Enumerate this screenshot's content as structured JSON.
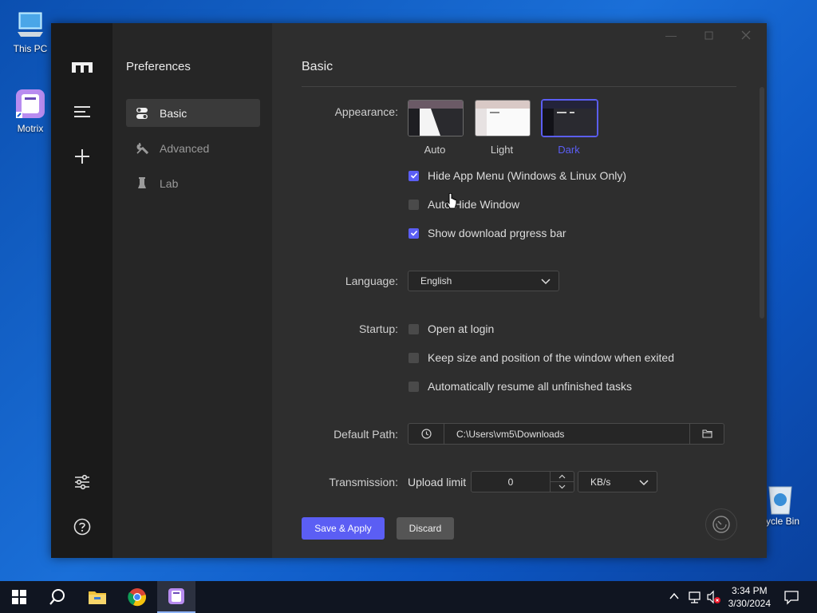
{
  "desktop": {
    "icons": [
      {
        "label": "This PC"
      },
      {
        "label": "Motrix"
      },
      {
        "label": "cycle Bin"
      }
    ]
  },
  "app": {
    "rail": {
      "icons": [
        "motrix-logo-icon",
        "menu-icon",
        "plus-icon",
        "settings-sliders-icon",
        "help-icon"
      ]
    },
    "subnav": {
      "title": "Preferences",
      "items": [
        {
          "label": "Basic",
          "icon": "toggle-icon",
          "active": true
        },
        {
          "label": "Advanced",
          "icon": "wrench-icon",
          "active": false
        },
        {
          "label": "Lab",
          "icon": "flask-icon",
          "active": false
        }
      ]
    },
    "main": {
      "title": "Basic",
      "appearance": {
        "label": "Appearance:",
        "options": [
          {
            "label": "Auto",
            "selected": false
          },
          {
            "label": "Light",
            "selected": false
          },
          {
            "label": "Dark",
            "selected": true
          }
        ],
        "checkboxes": [
          {
            "label": "Hide App Menu (Windows & Linux Only)",
            "checked": true
          },
          {
            "label": "Auto Hide Window",
            "checked": false
          },
          {
            "label": "Show download prgress bar",
            "checked": true
          }
        ]
      },
      "language": {
        "label": "Language:",
        "value": "English"
      },
      "startup": {
        "label": "Startup:",
        "checkboxes": [
          {
            "label": "Open at login",
            "checked": false
          },
          {
            "label": "Keep size and position of the window when exited",
            "checked": false
          },
          {
            "label": "Automatically resume all unfinished tasks",
            "checked": false
          }
        ]
      },
      "default_path": {
        "label": "Default Path:",
        "value": "C:\\Users\\vm5\\Downloads"
      },
      "transmission": {
        "label": "Transmission:",
        "upload_label": "Upload limit",
        "upload_value": "0",
        "unit": "KB/s"
      },
      "buttons": {
        "save": "Save & Apply",
        "discard": "Discard"
      }
    }
  },
  "taskbar": {
    "time": "3:34 PM",
    "date": "3/30/2024"
  },
  "colors": {
    "accent": "#5b5ef4",
    "rail_bg": "#1a1a1a",
    "panel_bg": "#2e2e2e"
  }
}
